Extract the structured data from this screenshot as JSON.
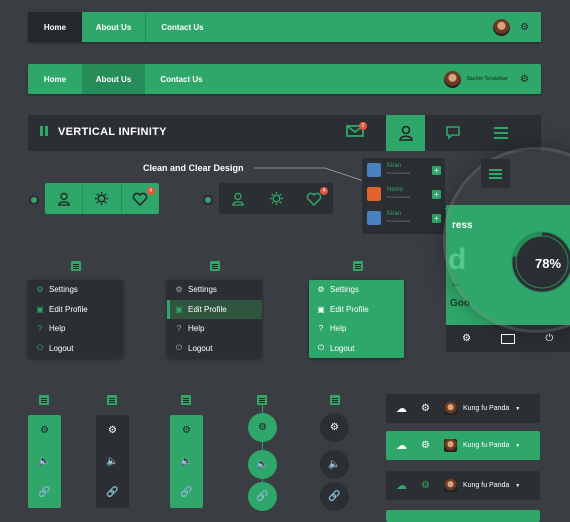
{
  "nav1": {
    "home": "Home",
    "about": "About Us",
    "contact": "Contact Us"
  },
  "nav2": {
    "home": "Home",
    "about": "About Us",
    "contact": "Contact Us",
    "user": "Sachin Tendulkar"
  },
  "header": {
    "title": "VERTICAL INFINITY",
    "mail_badge": "2"
  },
  "annotation": "Clean and Clear Design",
  "heart_badge": "4",
  "contacts": [
    {
      "name": "Kiran",
      "sub": "Normal Following"
    },
    {
      "name": "Nemo",
      "sub": "Normal Following"
    },
    {
      "name": "Kiran",
      "sub": "Normal Following"
    }
  ],
  "progress": {
    "label": "ress",
    "value": "78%",
    "big_letter": "d",
    "word": "Goo",
    "yo": "You"
  },
  "menu": [
    "Settings",
    "Edit Profile",
    "Help",
    "Logout"
  ],
  "user_bar_name": "Kung fu Panda",
  "colors": {
    "green": "#2fa76a",
    "green_dark": "#268c58",
    "dark": "#2b2e33",
    "bg": "#3a3d42",
    "red": "#e8533b"
  }
}
